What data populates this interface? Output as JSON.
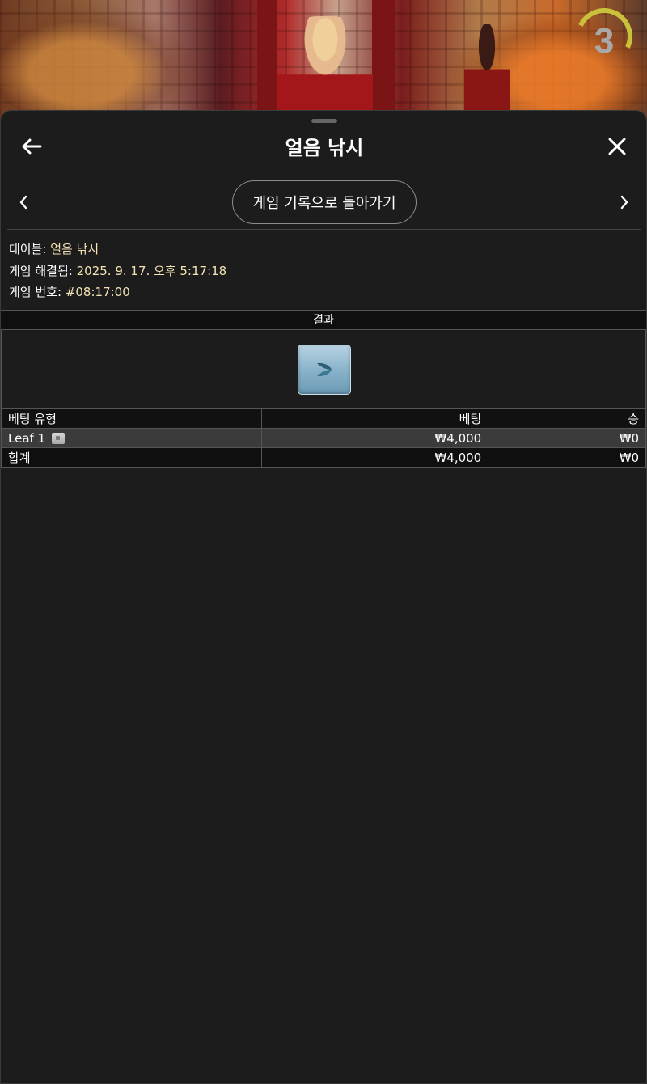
{
  "video": {
    "countdown": "3"
  },
  "header": {
    "title": "얼음 낚시"
  },
  "nav": {
    "back_to_history": "게임 기록으로 돌아가기"
  },
  "info": {
    "table_label": "테이블:",
    "table_value": "얼음 낚시",
    "resolved_label": "게임 해결됨:",
    "resolved_value": "2025. 9. 17. 오후 5:17:18",
    "number_label": "게임 번호:",
    "number_value": "#08:17:00"
  },
  "result": {
    "heading": "결과",
    "tile_icon": "leaf-fish-tile-icon",
    "tile_color": "#86b0c8"
  },
  "bets_table": {
    "headers": [
      "베팅 유형",
      "베팅",
      "승"
    ],
    "rows": [
      {
        "type": "Leaf 1",
        "bet": "₩4,000",
        "win": "₩0"
      }
    ],
    "total": {
      "label": "합계",
      "bet": "₩4,000",
      "win": "₩0"
    }
  },
  "colors": {
    "accent_value": "#f3e3b5",
    "panel_bg": "#1c1c1c",
    "highlight_row": "#3b3b3b"
  }
}
